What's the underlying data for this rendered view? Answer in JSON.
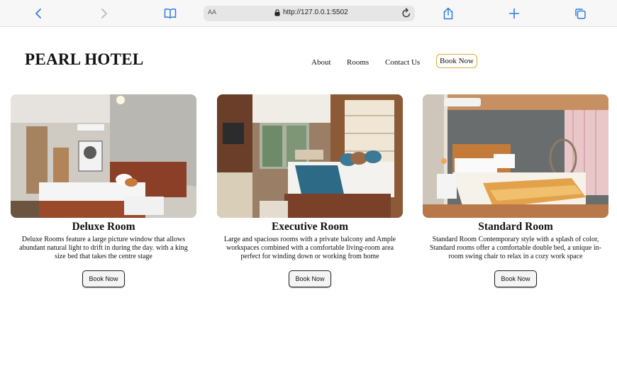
{
  "browser": {
    "url": "http://127.0.0.1:5502",
    "text_size_label": "AA"
  },
  "header": {
    "brand": "PEARL HOTEL",
    "nav": {
      "about": "About",
      "rooms": "Rooms",
      "contact": "Contact Us",
      "book": "Book Now"
    }
  },
  "rooms": [
    {
      "title": "Deluxe Room",
      "description": "Deluxe Rooms feature a large picture window that allows abundant natural light to drift in during the day. with a king size bed that takes the centre stage",
      "button": "Book Now"
    },
    {
      "title": "Executive Room",
      "description": "Large and spacious rooms with a private balcony and Ample workspaces combined with a comfortable living-room area perfect for winding down or working from home",
      "button": "Book Now"
    },
    {
      "title": "Standard Room",
      "description": "Standard Room Contemporary style with a splash of color, Standard rooms offer a comfortable double bed, a unique in-room swing chair to relax in a cozy work space",
      "button": "Book Now"
    }
  ],
  "colors": {
    "accent_book_border": "#e0a93a",
    "toolbar_icon": "#2f7de1"
  }
}
